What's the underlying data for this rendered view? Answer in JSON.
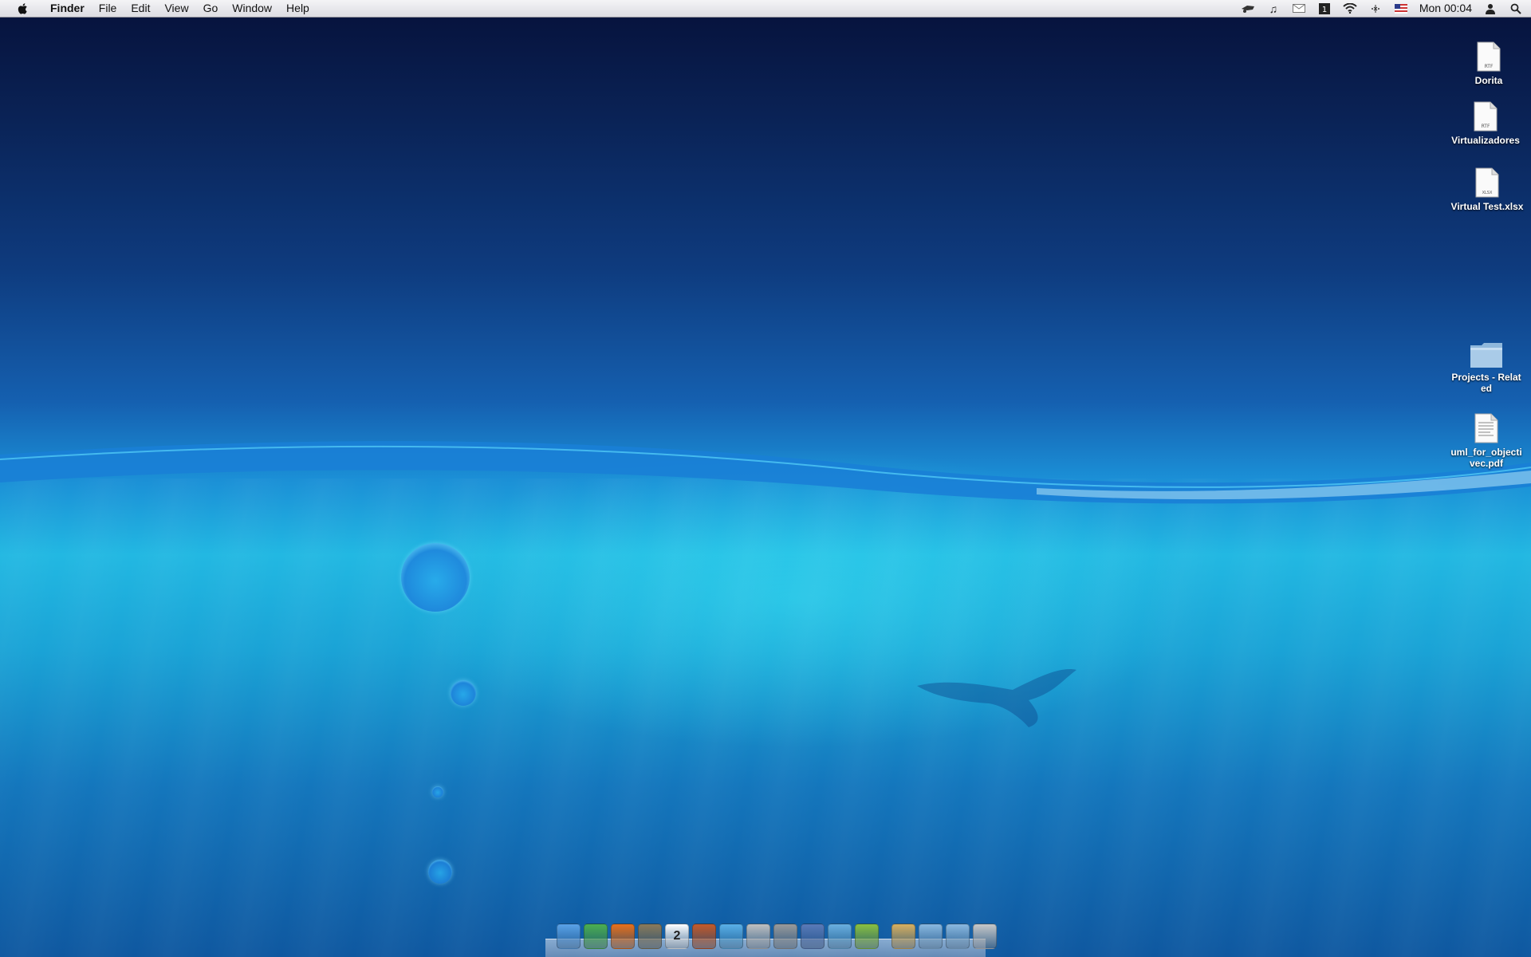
{
  "menubar": {
    "app_name": "Finder",
    "menus": [
      "File",
      "Edit",
      "View",
      "Go",
      "Window",
      "Help"
    ],
    "clock": "Mon 00:04",
    "status_icons": [
      "time-machine-icon",
      "itunes-icon",
      "mail-icon",
      "dashboard-icon",
      "wifi-icon",
      "bluetooth-icon",
      "input-flag-icon",
      "user-icon",
      "spotlight-icon"
    ]
  },
  "desktop": {
    "icons": [
      {
        "name": "Dorita",
        "type": "rtf",
        "badge": "RTF"
      },
      {
        "name": "Virtualizadores",
        "type": "rtf",
        "badge": "RTF"
      },
      {
        "name": "Virtual Test.xlsx",
        "type": "xlsx",
        "badge": "XLSX"
      },
      {
        "name": "Projects - Related",
        "type": "folder"
      },
      {
        "name": "uml_for_objectivec.pdf",
        "type": "pdf"
      }
    ]
  },
  "dock": {
    "items": [
      {
        "name": "finder-icon",
        "color": "#5aa2e8"
      },
      {
        "name": "adium-icon",
        "color": "#4caf50"
      },
      {
        "name": "firefox-icon",
        "color": "#e8701a"
      },
      {
        "name": "library-icon",
        "color": "#8a7a5a"
      },
      {
        "name": "ical-icon",
        "color": "#ffffff",
        "text": "2"
      },
      {
        "name": "iphoto-icon",
        "color": "#c45a2a"
      },
      {
        "name": "itunes-icon",
        "color": "#5ab0e8"
      },
      {
        "name": "app-icon",
        "color": "#c0c0c0"
      },
      {
        "name": "system-preferences-icon",
        "color": "#9a9a9a"
      },
      {
        "name": "xcode-icon",
        "color": "#5a7ab8"
      },
      {
        "name": "word-icon",
        "color": "#6ab0e0"
      },
      {
        "name": "app-green-icon",
        "color": "#8ac040"
      },
      {
        "name": "documents-stack-icon",
        "color": "#d8b060"
      },
      {
        "name": "applications-folder-icon",
        "color": "#8ab8e0"
      },
      {
        "name": "downloads-folder-icon",
        "color": "#8ab8e0"
      },
      {
        "name": "trash-icon",
        "color": "#c8c8c8"
      }
    ]
  }
}
